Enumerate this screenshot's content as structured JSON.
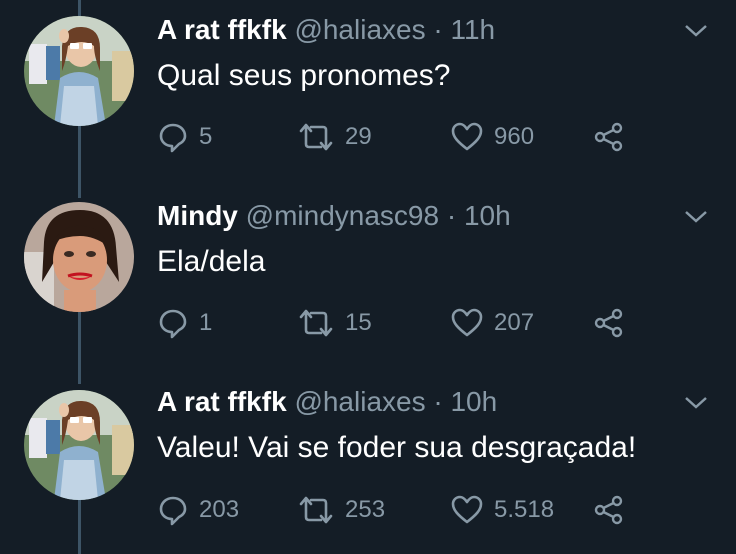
{
  "tweets": [
    {
      "name": "A rat ffkfk",
      "handle": "@haliaxes",
      "separator": "·",
      "time": "11h",
      "text": "Qual seus pronomes?",
      "replies": "5",
      "retweets": "29",
      "likes": "960"
    },
    {
      "name": "Mindy",
      "handle": "@mindynasc98",
      "separator": "·",
      "time": "10h",
      "text": "Ela/dela",
      "replies": "1",
      "retweets": "15",
      "likes": "207"
    },
    {
      "name": "A rat ffkfk",
      "handle": "@haliaxes",
      "separator": "·",
      "time": "10h",
      "text": "Valeu! Vai se foder sua desgraçada!",
      "replies": "203",
      "retweets": "253",
      "likes": "5.518"
    }
  ],
  "icons": {
    "reply": "reply-icon",
    "retweet": "retweet-icon",
    "like": "heart-icon",
    "share": "share-icon",
    "more": "chevron-down-icon"
  },
  "colors": {
    "background": "#141d26",
    "muted": "#8899a6",
    "thread_line": "#3d5466"
  }
}
